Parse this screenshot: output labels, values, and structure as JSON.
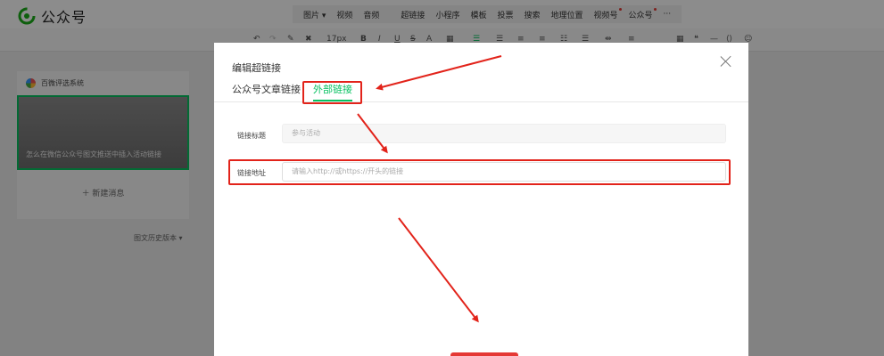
{
  "header": {
    "logo_text": "公众号",
    "menu": [
      {
        "label": "图片",
        "caret": "▾"
      },
      {
        "label": "视频"
      },
      {
        "label": "音频"
      },
      {
        "label": "超链接"
      },
      {
        "label": "小程序"
      },
      {
        "label": "模板"
      },
      {
        "label": "投票"
      },
      {
        "label": "搜索"
      },
      {
        "label": "地理位置"
      },
      {
        "label": "视频号",
        "dot": true
      },
      {
        "label": "公众号",
        "dot": true
      },
      {
        "label": "···"
      }
    ]
  },
  "toolbar": {
    "font_size": "17px",
    "bold": "B",
    "italic": "I",
    "underline": "U",
    "strike": "S",
    "font_color": "A"
  },
  "left_panel": {
    "account_name": "百微评选系统",
    "cover_title": "怎么在微信公众号图文推送中插入活动链接",
    "new_message": "＋ 新建消息",
    "history": "图文历史版本 ▾"
  },
  "dialog": {
    "title": "编辑超链接",
    "tabs": [
      {
        "label": "公众号文章链接",
        "active": false
      },
      {
        "label": "外部链接",
        "active": true
      }
    ],
    "fields": {
      "title_label": "链接标题",
      "title_placeholder": "参与活动",
      "url_label": "链接地址",
      "url_placeholder": "请输入http://或https://开头的链接"
    }
  },
  "colors": {
    "accent": "#07c160",
    "annotation": "#e2231a"
  }
}
